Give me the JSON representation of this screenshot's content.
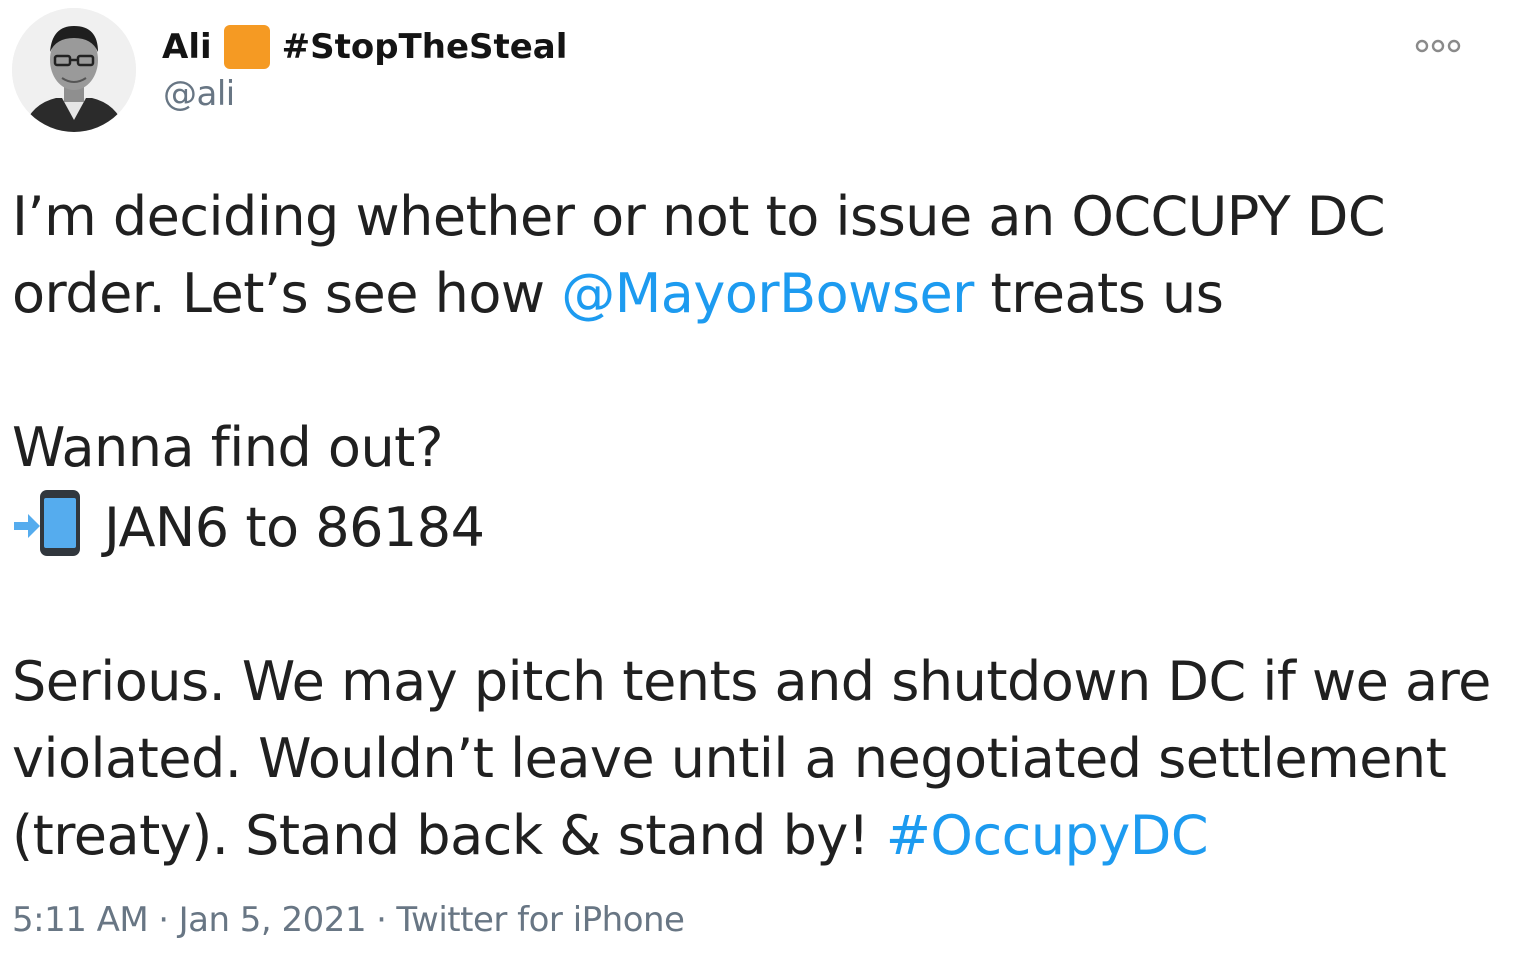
{
  "author": {
    "display_name": "Ali",
    "name_badge_color": "#F59A23",
    "name_tag": "#StopTheSteal",
    "handle": "@ali",
    "avatar_icon": "profile-photo"
  },
  "menu": {
    "icon": "more-options-icon"
  },
  "tweet": {
    "line1": "I’m deciding whether or not to issue an OCCUPY DC",
    "line2_before": "order. Let’s see how ",
    "mention": "@MayorBowser",
    "line2_after": " treats us",
    "line3": "Wanna find out?",
    "sms_icon": "phone-with-arrow-icon",
    "line4": "JAN6 to 86184",
    "line5": "Serious. We may pitch tents and shutdown DC if we are",
    "line6": "violated. Wouldn’t leave until a negotiated settlement",
    "line7_before": "(treaty). Stand back & stand by! ",
    "hashtag": "#OccupyDC"
  },
  "meta": {
    "time": "5:11 AM",
    "separator": "·",
    "date": "Jan 5, 2021",
    "source": "Twitter for iPhone"
  },
  "colors": {
    "link": "#1D9BF0",
    "secondary_text": "#687684",
    "primary_text": "#202020"
  }
}
